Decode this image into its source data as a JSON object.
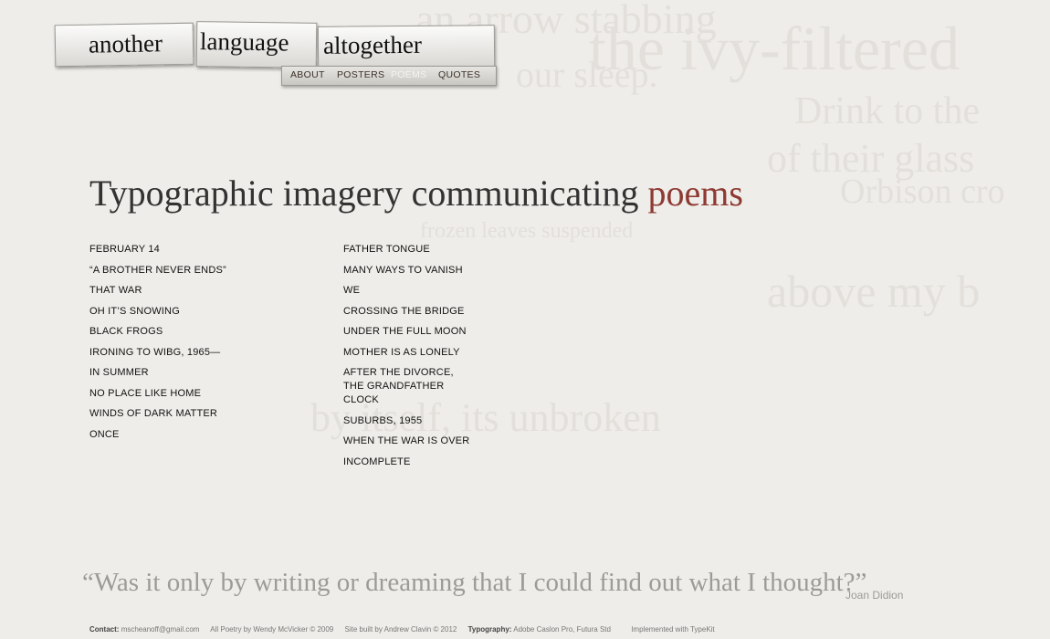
{
  "background_words": [
    "an arrow stabbing",
    "the ivy-filtered",
    "our sleep.",
    "Drink to the",
    "of their glass",
    "Orbison cro",
    "frozen leaves suspended",
    "above my b",
    "by itself, its unbroken"
  ],
  "logo": {
    "words": [
      "another",
      "language",
      "altogether"
    ]
  },
  "nav": {
    "items": [
      "ABOUT",
      "POSTERS",
      "POEMS",
      "QUOTES"
    ],
    "active": "POEMS"
  },
  "headline": {
    "main": "Typographic imagery communicating ",
    "accent": "poems"
  },
  "poems_left": [
    "FEBRUARY 14",
    "“A BROTHER NEVER ENDS”",
    "THAT WAR",
    "OH IT’S SNOWING",
    "BLACK FROGS",
    "IRONING TO WIBG, 1965—",
    "IN SUMMER",
    "NO PLACE LIKE HOME",
    "WINDS OF DARK MATTER",
    "ONCE"
  ],
  "poems_right": [
    "FATHER TONGUE",
    "MANY WAYS TO VANISH",
    "WE",
    "CROSSING THE BRIDGE",
    "UNDER THE FULL MOON",
    "MOTHER IS AS LONELY",
    "AFTER THE DIVORCE, THE GRANDFATHER CLOCK",
    "SUBURBS, 1955",
    "WHEN THE WAR IS OVER",
    "INCOMPLETE"
  ],
  "quote": {
    "text": "“Was it only by writing or dreaming that I could find out what I thought?”",
    "author": "Joan Didion"
  },
  "footer": {
    "contact_label": "Contact:",
    "contact_value": "mscheanoff@gmail.com",
    "poetry": "All Poetry by Wendy McVicker © 2009",
    "built": "Site built by Andrew Clavin © 2012",
    "typography_label": "Typography:",
    "typography_value": "Adobe Caslon Pro, Futura Std",
    "implemented": "Implemented with TypeKit"
  },
  "colors": {
    "background": "#efede9",
    "accent": "#8e3a33",
    "nav_active": "#f6f3ef",
    "quote": "#9d9b97"
  }
}
